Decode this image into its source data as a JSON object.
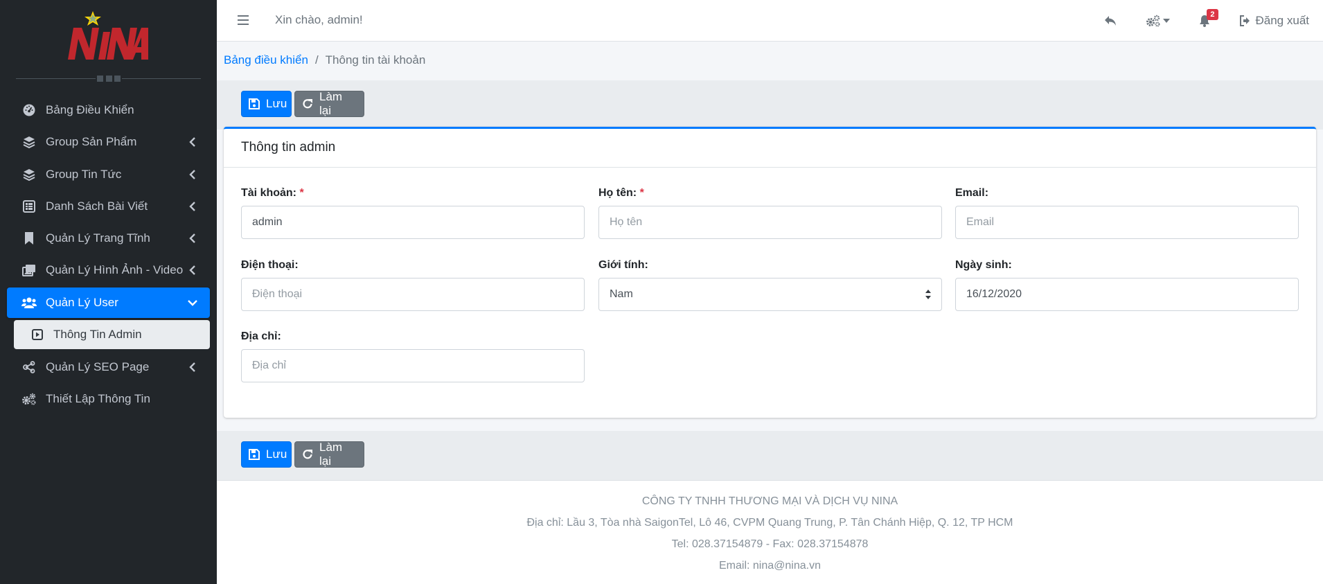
{
  "brand": {
    "logo_text": "NINA",
    "star_color": "#ffd700",
    "logo_color": "#c1272d"
  },
  "topbar": {
    "greeting": "Xin chào, admin!",
    "notification_count": "2",
    "logout_label": "Đăng xuất"
  },
  "sidebar": {
    "items": [
      {
        "label": "Bảng Điều Khiển",
        "icon": "dashboard-icon"
      },
      {
        "label": "Group Sản Phẩm",
        "icon": "layers-icon"
      },
      {
        "label": "Group Tin Tức",
        "icon": "layers-icon"
      },
      {
        "label": "Danh Sách Bài Viết",
        "icon": "list-table-icon"
      },
      {
        "label": "Quản Lý Trang Tĩnh",
        "icon": "bookmark-icon"
      },
      {
        "label": "Quản Lý Hình Ảnh - Video",
        "icon": "photo-video-icon"
      },
      {
        "label": "Quản Lý User",
        "icon": "users-icon"
      },
      {
        "label": "Quản Lý SEO Page",
        "icon": "share-icon"
      },
      {
        "label": "Thiết Lập Thông Tin",
        "icon": "cogs-icon"
      }
    ],
    "sub_item": {
      "label": "Thông Tin Admin",
      "icon": "play-square-icon"
    }
  },
  "breadcrumb": {
    "home": "Bảng điều khiển",
    "current": "Thông tin tài khoản"
  },
  "actions": {
    "save": "Lưu",
    "reset": "Làm lại"
  },
  "card": {
    "title": "Thông tin admin"
  },
  "form": {
    "username": {
      "label": "Tài khoản:",
      "value": "admin"
    },
    "fullname": {
      "label": "Họ tên:",
      "placeholder": "Họ tên"
    },
    "email": {
      "label": "Email:",
      "placeholder": "Email"
    },
    "phone": {
      "label": "Điện thoại:",
      "placeholder": "Điện thoại"
    },
    "gender": {
      "label": "Giới tính:",
      "value": "Nam"
    },
    "birthday": {
      "label": "Ngày sinh:",
      "value": "16/12/2020"
    },
    "address": {
      "label": "Địa chỉ:",
      "placeholder": "Địa chỉ"
    },
    "required_mark": "*"
  },
  "footer": {
    "company": "CÔNG TY TNHH THƯƠNG MẠI VÀ DỊCH VỤ NINA",
    "address": "Địa chỉ: Lầu 3, Tòa nhà SaigonTel, Lô 46, CVPM Quang Trung, P. Tân Chánh Hiệp, Q. 12, TP HCM",
    "phone": "Tel: 028.37154879 - Fax: 028.37154878",
    "email": "Email: nina@nina.vn"
  },
  "colors": {
    "primary": "#007bff",
    "sidebar_bg": "#22262a",
    "danger": "#dc3545",
    "secondary": "#6c757d"
  }
}
